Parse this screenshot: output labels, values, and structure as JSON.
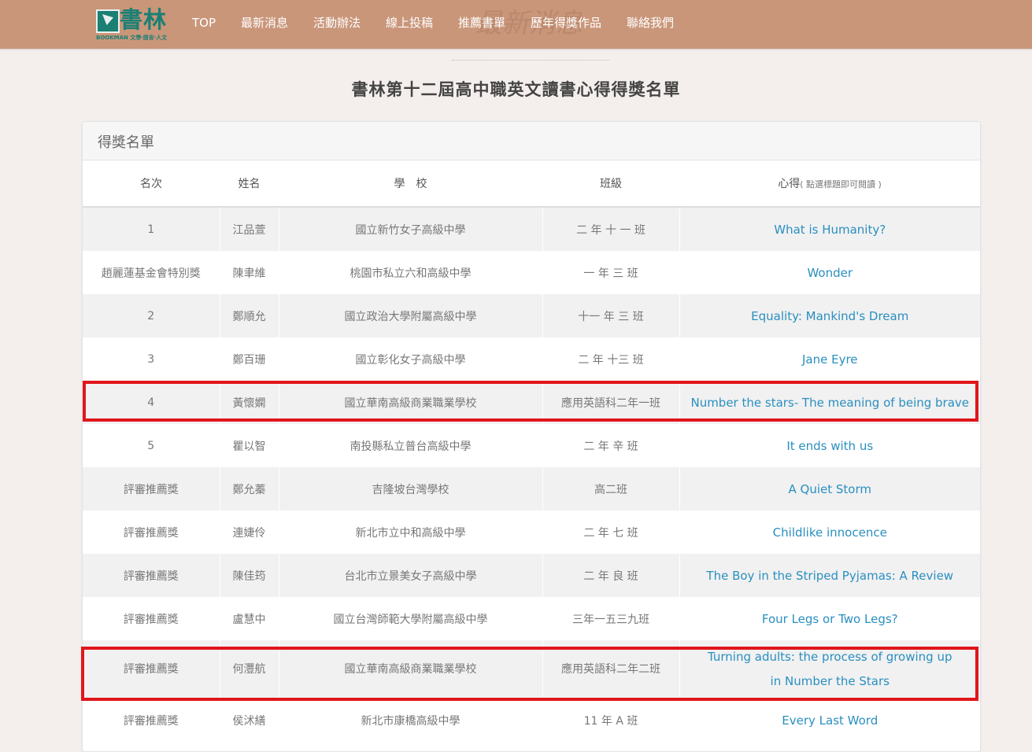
{
  "logo": {
    "text": "書林",
    "sub": "BOOKMAN 文學‧語言‧人文"
  },
  "nav": [
    {
      "label": "TOP"
    },
    {
      "label": "最新消息"
    },
    {
      "label": "活動辦法"
    },
    {
      "label": "線上投稿"
    },
    {
      "label": "推薦書單"
    },
    {
      "label": "歷年得獎作品"
    },
    {
      "label": "聯絡我們"
    }
  ],
  "nav_watermark": "最新消息",
  "page_title": "書林第十二屆高中職英文讀書心得得獎名單",
  "panel_title": "得獎名單",
  "headers": {
    "rank": "名次",
    "name": "姓名",
    "school": "學　校",
    "class": "班級",
    "essay": "心得",
    "essay_hint": "( 點選標題即可閱讀 )"
  },
  "rows": [
    {
      "rank": "1",
      "name": "江品萱",
      "school": "國立新竹女子高級中學",
      "class": "二 年 十 一 班",
      "essay": "What is Humanity?"
    },
    {
      "rank": "趙麗蓮基金會特別獎",
      "name": "陳聿維",
      "school": "桃園市私立六和高級中學",
      "class": "一 年 三 班",
      "essay": "Wonder"
    },
    {
      "rank": "2",
      "name": "鄭順允",
      "school": "國立政治大學附屬高級中學",
      "class": "十一 年 三 班",
      "essay": "Equality: Mankind's Dream"
    },
    {
      "rank": "3",
      "name": "鄭百珊",
      "school": "國立彰化女子高級中學",
      "class": "二 年 十三 班",
      "essay": "Jane Eyre"
    },
    {
      "rank": "4",
      "name": "黃懷嫻",
      "school": "國立華南高級商業職業學校",
      "class": "應用英語科二年一班",
      "essay": "Number the stars- The meaning of being brave"
    },
    {
      "rank": "5",
      "name": "瞿以智",
      "school": "南投縣私立普台高級中學",
      "class": "二 年 辛 班",
      "essay": "It ends with us"
    },
    {
      "rank": "評審推薦獎",
      "name": "鄭允蓁",
      "school": "吉隆坡台灣學校",
      "class": "高二班",
      "essay": "A Quiet Storm"
    },
    {
      "rank": "評審推薦獎",
      "name": "連婕伶",
      "school": "新北市立中和高級中學",
      "class": "二 年 七 班",
      "essay": "Childlike innocence"
    },
    {
      "rank": "評審推薦獎",
      "name": "陳佳筠",
      "school": "台北市立景美女子高級中學",
      "class": "二 年 良 班",
      "essay": "The Boy in the Striped Pyjamas: A Review"
    },
    {
      "rank": "評審推薦獎",
      "name": "盧慧中",
      "school": "國立台灣師範大學附屬高級中學",
      "class": "三年一五三九班",
      "essay": "Four Legs or Two Legs?"
    },
    {
      "rank": "評審推薦獎",
      "name": "何灃航",
      "school": "國立華南高級商業職業學校",
      "class": "應用英語科二年二班",
      "essay": "Turning adults: the process of growing up",
      "essay2": "in Number the Stars"
    },
    {
      "rank": "評審推薦獎",
      "name": "侯沭繕",
      "school": "新北市康橋高級中學",
      "class": "11 年 A 班",
      "essay": "Every Last Word"
    }
  ],
  "colors": {
    "topbar": "#c9967a",
    "link": "#2a8fc0",
    "highlight": "#e0161b",
    "logo": "#1b7f74"
  }
}
